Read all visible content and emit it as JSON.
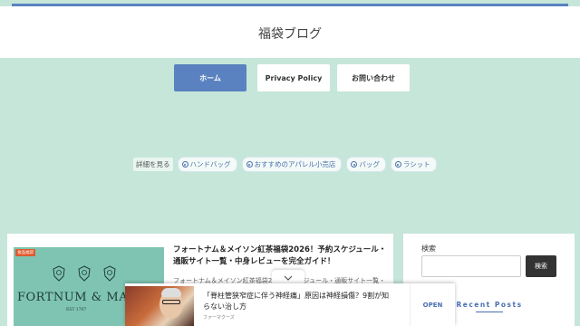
{
  "site": {
    "title": "福袋ブログ"
  },
  "nav": {
    "home": "ホーム",
    "privacy": "Privacy Policy",
    "contact": "お問い合わせ"
  },
  "tags": {
    "label": "詳細を見る",
    "items": [
      "ハンドバッグ",
      "おすすめのアパレル小売店",
      "バッグ",
      "ラシット"
    ]
  },
  "post": {
    "category": "食品福袋",
    "thumb_brand": "FORTNUM & MAS",
    "thumb_est": "EST 1707",
    "title": "フォートナム＆メイソン紅茶福袋2026！予約スケジュール・通販サイト一覧・中身レビューを完全ガイド！",
    "excerpt": "フォートナム＆メイソン紅茶福袋2026…スケジュール・通販サイト一覧・"
  },
  "sidebar": {
    "search_label": "検索",
    "search_button": "検索",
    "recent_posts": "Recent Posts"
  },
  "ad": {
    "text": "「脊柱管狭窄症に伴う神経痛」原因は神経損傷？9割が知らない治し方",
    "source": "ファーマクーズ",
    "open": "OPEN"
  },
  "colors": {
    "accent": "#5a82c0",
    "background": "#c5e6d9"
  }
}
